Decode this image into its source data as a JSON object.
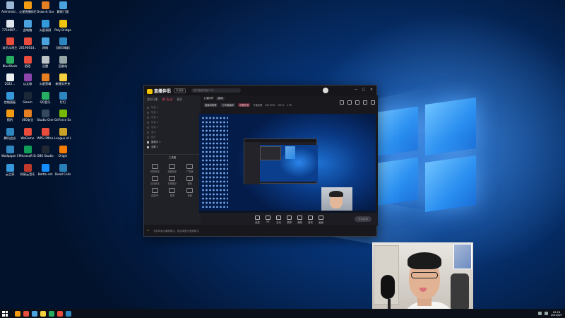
{
  "desktop": {
    "icons": [
      {
        "label": "Administr...",
        "color": "#9bb7d4"
      },
      {
        "label": "火星直播伴侣",
        "color": "#f39c12"
      },
      {
        "label": "Draw & Guess",
        "color": "#e67e22"
      },
      {
        "label": "解除门锁",
        "color": "#4aa3df"
      },
      {
        "label": "7754897...",
        "color": "#dfe6ee"
      },
      {
        "label": "此电脑",
        "color": "#4aa3df"
      },
      {
        "label": "火星录屏",
        "color": "#3498db"
      },
      {
        "label": "Poly Bridge",
        "color": "#f1c40f"
      },
      {
        "label": "欢乐斗地主",
        "color": "#e74c3c"
      },
      {
        "label": "20190614...",
        "color": "#e74c3c"
      },
      {
        "label": "网络",
        "color": "#4aa3df"
      },
      {
        "label": "剑网3缘起",
        "color": "#2e86c1"
      },
      {
        "label": "BlueStack",
        "color": "#27ae60"
      },
      {
        "label": "陌陌",
        "color": "#e74c3c"
      },
      {
        "label": "迅雷",
        "color": "#bdc3c7"
      },
      {
        "label": "回收站",
        "color": "#95a5a6"
      },
      {
        "label": "2022...",
        "color": "#ecf0f1"
      },
      {
        "label": "以太修",
        "color": "#8e44ad"
      },
      {
        "label": "火星剪辑",
        "color": "#e67e22"
      },
      {
        "label": "新建文件夹",
        "color": "#f4d03f"
      },
      {
        "label": "控制面板",
        "color": "#3498db"
      },
      {
        "label": "Steam",
        "color": "#1b2838"
      },
      {
        "label": "QQ音乐",
        "color": "#27ae60"
      },
      {
        "label": "钉钉",
        "color": "#2e86c1"
      },
      {
        "label": "猎豹",
        "color": "#f39c12"
      },
      {
        "label": "360安全",
        "color": "#e67e22"
      },
      {
        "label": "Studio One",
        "color": "#34495e"
      },
      {
        "label": "GeForce Experience",
        "color": "#76b900"
      },
      {
        "label": "腾讯会议",
        "color": "#2e86c1"
      },
      {
        "label": "WeGame",
        "color": "#e74c3c"
      },
      {
        "label": "WPS Office",
        "color": "#e74c3c"
      },
      {
        "label": "League of Legends",
        "color": "#c9a227"
      },
      {
        "label": "Wallpaper Engine",
        "color": "#2e86c1"
      },
      {
        "label": "Microsoft Edge",
        "color": "#0f9d58"
      },
      {
        "label": "OBS Studio",
        "color": "#222831"
      },
      {
        "label": "Origin",
        "color": "#f57c00"
      },
      {
        "label": "云之家",
        "color": "#3498db"
      },
      {
        "label": "网易云音乐",
        "color": "#c0392b"
      },
      {
        "label": "Battle.net",
        "color": "#148eff"
      },
      {
        "label": "Dead Cells",
        "color": "#2980b9"
      }
    ],
    "wallpaper_colors": {
      "deep": "#02122c",
      "mid": "#0b4fb0",
      "glow": "#6fc2ff"
    }
  },
  "app": {
    "logo_text": "直播伴侣",
    "version_badge": "抖音版",
    "search_placeholder": "如何提高开播人气？",
    "window_controls": [
      "—",
      "□",
      "✕"
    ],
    "left_tabs": [
      {
        "label": "我的开播",
        "active": false
      },
      {
        "label": "热门玩法",
        "active": true
      },
      {
        "label": "更多",
        "active": false
      }
    ],
    "left_rows": [
      {
        "label": "场景 1",
        "lit": false
      },
      {
        "label": "场景 2",
        "lit": false
      },
      {
        "label": "场景 3",
        "lit": false
      },
      {
        "label": "场景 4",
        "lit": false
      },
      {
        "label": "场景 5",
        "lit": false
      },
      {
        "label": "窗口",
        "lit": false
      },
      {
        "label": "图片",
        "lit": false
      },
      {
        "label": "摄像头 1",
        "lit": true
      },
      {
        "label": "全屏 1",
        "lit": true
      }
    ],
    "tools_header": "工具箱",
    "tools": [
      "阿豆声控",
      "弹幕助手",
      "广告牌",
      "互动玩法",
      "礼物展示",
      "音效",
      "连麦PK",
      "更多",
      "设置"
    ],
    "stream_title": "主播推荐",
    "stream_tag": "游戏",
    "sub_items": [
      {
        "label": "直播间管理",
        "style": "pill"
      },
      {
        "label": "分享直播间",
        "style": "pill"
      },
      {
        "label": "观看数据",
        "style": "red"
      },
      {
        "label": "开播权限",
        "style": "plain"
      },
      {
        "label": "6874935",
        "style": "plain"
      },
      {
        "label": "8431",
        "style": "plain"
      },
      {
        "label": "278",
        "style": "plain"
      }
    ],
    "bottom_actions": [
      "连麦",
      "PK",
      "互动",
      "录屏",
      "美颜",
      "音效",
      "画面"
    ],
    "start_label": "开始直播",
    "status_text": "当前场景为横屏模式，建议调整为竖屏模式",
    "status_warn": "⚠"
  },
  "taskbar": {
    "time": "20:16",
    "date": "2022/6/7",
    "apps": [
      "#f39c12",
      "#e74c3c",
      "#4aa3df",
      "#f4d03f",
      "#27ae60",
      "#e74c3c",
      "#2e86c1"
    ]
  }
}
